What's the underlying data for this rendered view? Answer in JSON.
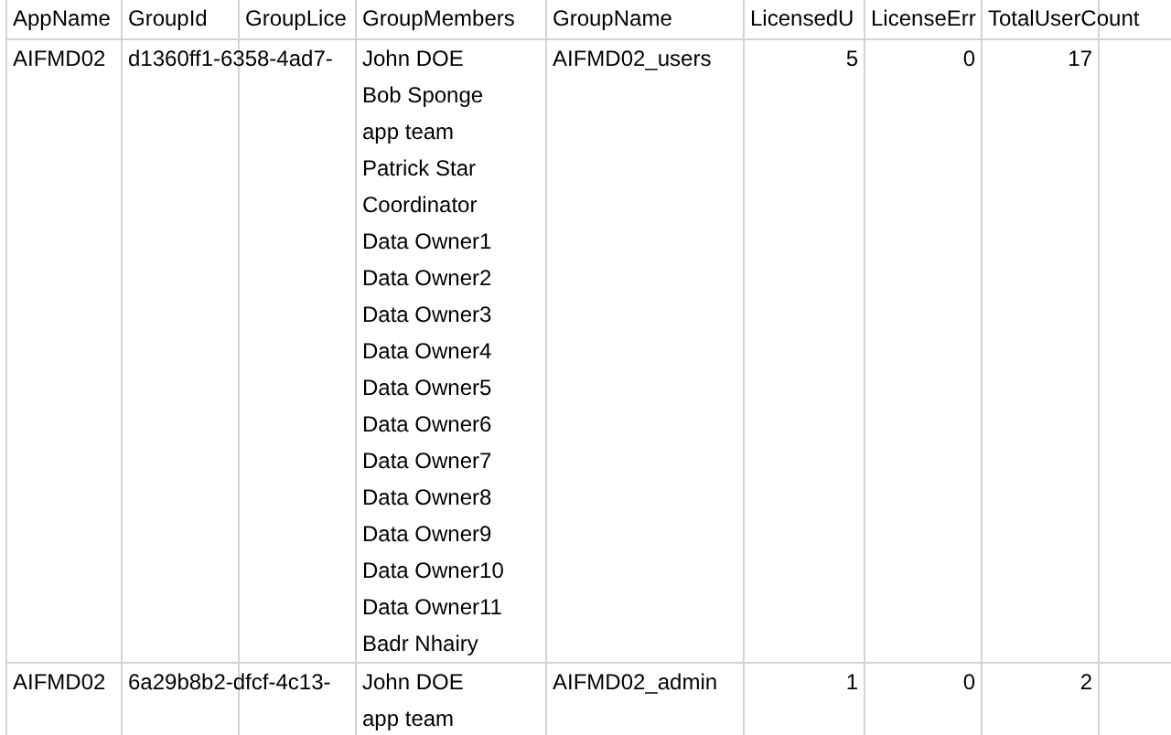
{
  "table": {
    "columns": [
      "AppName",
      "GroupId",
      "GroupLice",
      "GroupMembers",
      "GroupName",
      "LicensedU",
      "LicenseErr",
      "TotalUserCount"
    ],
    "rows": [
      {
        "app_name": "AIFMD02",
        "group_id": "d1360ff1-6358-4ad7-",
        "group_members": [
          "John DOE",
          "Bob Sponge",
          "app team",
          "Patrick Star",
          "Coordinator",
          "Data Owner1",
          "Data Owner2",
          "Data Owner3",
          "Data Owner4",
          "Data Owner5",
          "Data Owner6",
          "Data Owner7",
          "Data Owner8",
          "Data Owner9",
          "Data Owner10",
          "Data Owner11",
          "Badr Nhairy"
        ],
        "group_name": "AIFMD02_users",
        "licensed_users": "5",
        "license_errors": "0",
        "total_user_count": "17"
      },
      {
        "app_name": "AIFMD02",
        "group_id": "6a29b8b2-dfcf-4c13-",
        "group_members": [
          "John DOE",
          "app team"
        ],
        "group_name": "AIFMD02_admin",
        "licensed_users": "1",
        "license_errors": "0",
        "total_user_count": "2"
      }
    ]
  }
}
